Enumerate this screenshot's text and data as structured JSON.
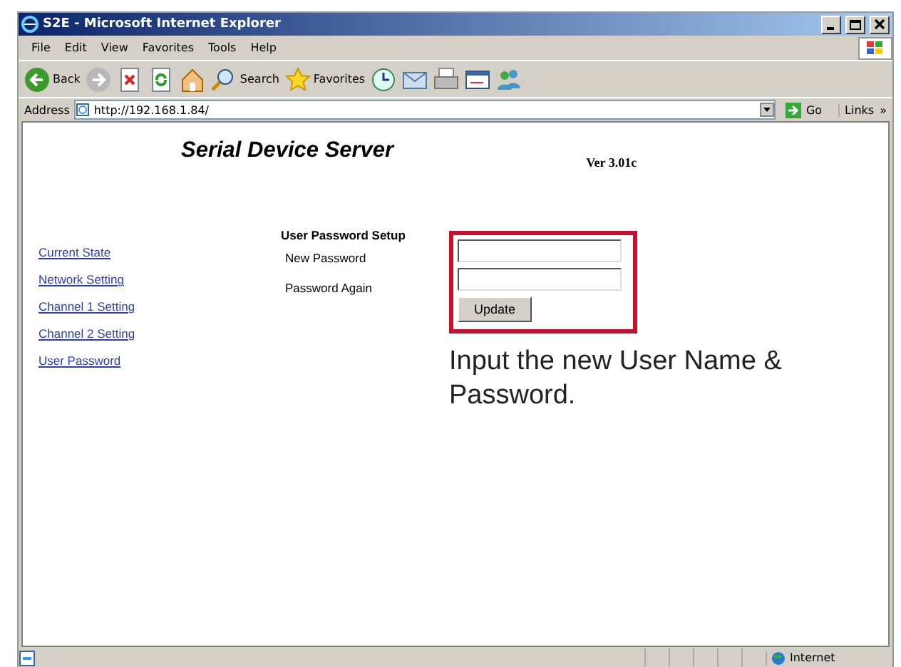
{
  "window": {
    "title": "S2E - Microsoft Internet Explorer"
  },
  "menu": [
    "File",
    "Edit",
    "View",
    "Favorites",
    "Tools",
    "Help"
  ],
  "toolbar": [
    {
      "kind": "back",
      "label": "Back"
    },
    {
      "kind": "forward"
    },
    {
      "kind": "stop"
    },
    {
      "kind": "refresh"
    },
    {
      "kind": "home"
    },
    {
      "kind": "search",
      "label": "Search"
    },
    {
      "kind": "favorites",
      "label": "Favorites"
    },
    {
      "kind": "history"
    },
    {
      "kind": "mail"
    },
    {
      "kind": "print"
    },
    {
      "kind": "edit"
    },
    {
      "kind": "messenger"
    }
  ],
  "address": {
    "label": "Address",
    "url": "http://192.168.1.84/",
    "go": "Go",
    "links": "Links",
    "more": "»"
  },
  "page": {
    "title": "Serial Device Server",
    "version": "Ver 3.01c",
    "nav": [
      "Current State",
      "Network Setting",
      "Channel 1 Setting",
      "Channel 2 Setting",
      "User Password"
    ],
    "form": {
      "heading": "User Password Setup",
      "fields": [
        {
          "label": "New Password"
        },
        {
          "label": "Password Again"
        }
      ],
      "button": "Update"
    },
    "note": "Input the new User Name & Password."
  },
  "status_bar": {
    "zone": "Internet"
  }
}
